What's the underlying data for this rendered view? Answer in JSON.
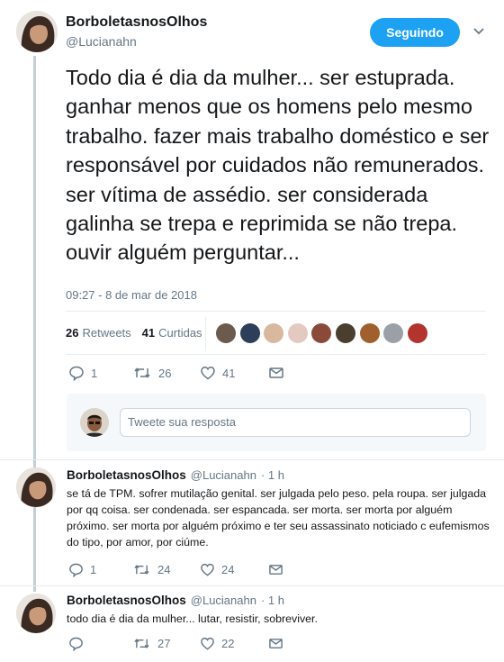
{
  "main_tweet": {
    "author_name": "BorboletasnosOlhos",
    "author_handle": "@Lucianahn",
    "follow_label": "Seguindo",
    "text": "Todo dia é dia da mulher... ser estuprada. ganhar menos que os homens pelo mesmo trabalho. fazer mais trabalho doméstico e ser responsável por cuidados não remunerados. ser vítima de assédio. ser considerada galinha se trepa e reprimida se não trepa. ouvir alguém perguntar...",
    "timestamp": "09:27 - 8 de mar de 2018",
    "retweets_count": "26",
    "retweets_label": "Retweets",
    "likes_count": "41",
    "likes_label": "Curtidas",
    "actions": {
      "replies": "1",
      "retweets": "26",
      "likes": "41"
    }
  },
  "reply_box": {
    "placeholder": "Tweete sua resposta"
  },
  "replies": [
    {
      "author_name": "BorboletasnosOlhos",
      "author_handle": "@Lucianahn",
      "time": "· 1 h",
      "text": "se tá de TPM. sofrer mutilação genital. ser julgada pelo peso. pela roupa. ser julgada por qq coisa. ser condenada. ser espancada. ser morta. ser morta por alguém próximo. ser morta por alguém próximo e ter seu assassinato noticiado c eufemismos do tipo, por amor, por ciúme.",
      "actions": {
        "replies": "1",
        "retweets": "24",
        "likes": "24"
      }
    },
    {
      "author_name": "BorboletasnosOlhos",
      "author_handle": "@Lucianahn",
      "time": "· 1 h",
      "text": "todo dia é dia da mulher... lutar, resistir, sobreviver.",
      "actions": {
        "replies": "",
        "retweets": "27",
        "likes": "22"
      }
    }
  ],
  "colors": {
    "accent": "#1da1f2",
    "text": "#14171a",
    "muted": "#657786",
    "thread_line": "#c4cfd6"
  },
  "icons": [
    "reply-icon",
    "retweet-icon",
    "like-icon",
    "dm-icon",
    "chevron-down-icon"
  ]
}
